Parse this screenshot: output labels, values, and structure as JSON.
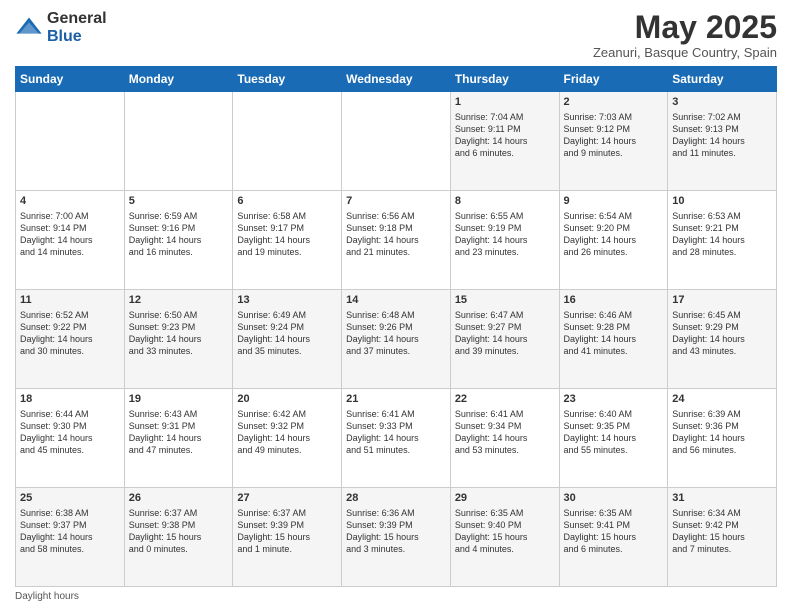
{
  "header": {
    "logo_general": "General",
    "logo_blue": "Blue",
    "month_title": "May 2025",
    "location": "Zeanuri, Basque Country, Spain"
  },
  "weekdays": [
    "Sunday",
    "Monday",
    "Tuesday",
    "Wednesday",
    "Thursday",
    "Friday",
    "Saturday"
  ],
  "weeks": [
    [
      {
        "day": "",
        "info": ""
      },
      {
        "day": "",
        "info": ""
      },
      {
        "day": "",
        "info": ""
      },
      {
        "day": "",
        "info": ""
      },
      {
        "day": "1",
        "info": "Sunrise: 7:04 AM\nSunset: 9:11 PM\nDaylight: 14 hours\nand 6 minutes."
      },
      {
        "day": "2",
        "info": "Sunrise: 7:03 AM\nSunset: 9:12 PM\nDaylight: 14 hours\nand 9 minutes."
      },
      {
        "day": "3",
        "info": "Sunrise: 7:02 AM\nSunset: 9:13 PM\nDaylight: 14 hours\nand 11 minutes."
      }
    ],
    [
      {
        "day": "4",
        "info": "Sunrise: 7:00 AM\nSunset: 9:14 PM\nDaylight: 14 hours\nand 14 minutes."
      },
      {
        "day": "5",
        "info": "Sunrise: 6:59 AM\nSunset: 9:16 PM\nDaylight: 14 hours\nand 16 minutes."
      },
      {
        "day": "6",
        "info": "Sunrise: 6:58 AM\nSunset: 9:17 PM\nDaylight: 14 hours\nand 19 minutes."
      },
      {
        "day": "7",
        "info": "Sunrise: 6:56 AM\nSunset: 9:18 PM\nDaylight: 14 hours\nand 21 minutes."
      },
      {
        "day": "8",
        "info": "Sunrise: 6:55 AM\nSunset: 9:19 PM\nDaylight: 14 hours\nand 23 minutes."
      },
      {
        "day": "9",
        "info": "Sunrise: 6:54 AM\nSunset: 9:20 PM\nDaylight: 14 hours\nand 26 minutes."
      },
      {
        "day": "10",
        "info": "Sunrise: 6:53 AM\nSunset: 9:21 PM\nDaylight: 14 hours\nand 28 minutes."
      }
    ],
    [
      {
        "day": "11",
        "info": "Sunrise: 6:52 AM\nSunset: 9:22 PM\nDaylight: 14 hours\nand 30 minutes."
      },
      {
        "day": "12",
        "info": "Sunrise: 6:50 AM\nSunset: 9:23 PM\nDaylight: 14 hours\nand 33 minutes."
      },
      {
        "day": "13",
        "info": "Sunrise: 6:49 AM\nSunset: 9:24 PM\nDaylight: 14 hours\nand 35 minutes."
      },
      {
        "day": "14",
        "info": "Sunrise: 6:48 AM\nSunset: 9:26 PM\nDaylight: 14 hours\nand 37 minutes."
      },
      {
        "day": "15",
        "info": "Sunrise: 6:47 AM\nSunset: 9:27 PM\nDaylight: 14 hours\nand 39 minutes."
      },
      {
        "day": "16",
        "info": "Sunrise: 6:46 AM\nSunset: 9:28 PM\nDaylight: 14 hours\nand 41 minutes."
      },
      {
        "day": "17",
        "info": "Sunrise: 6:45 AM\nSunset: 9:29 PM\nDaylight: 14 hours\nand 43 minutes."
      }
    ],
    [
      {
        "day": "18",
        "info": "Sunrise: 6:44 AM\nSunset: 9:30 PM\nDaylight: 14 hours\nand 45 minutes."
      },
      {
        "day": "19",
        "info": "Sunrise: 6:43 AM\nSunset: 9:31 PM\nDaylight: 14 hours\nand 47 minutes."
      },
      {
        "day": "20",
        "info": "Sunrise: 6:42 AM\nSunset: 9:32 PM\nDaylight: 14 hours\nand 49 minutes."
      },
      {
        "day": "21",
        "info": "Sunrise: 6:41 AM\nSunset: 9:33 PM\nDaylight: 14 hours\nand 51 minutes."
      },
      {
        "day": "22",
        "info": "Sunrise: 6:41 AM\nSunset: 9:34 PM\nDaylight: 14 hours\nand 53 minutes."
      },
      {
        "day": "23",
        "info": "Sunrise: 6:40 AM\nSunset: 9:35 PM\nDaylight: 14 hours\nand 55 minutes."
      },
      {
        "day": "24",
        "info": "Sunrise: 6:39 AM\nSunset: 9:36 PM\nDaylight: 14 hours\nand 56 minutes."
      }
    ],
    [
      {
        "day": "25",
        "info": "Sunrise: 6:38 AM\nSunset: 9:37 PM\nDaylight: 14 hours\nand 58 minutes."
      },
      {
        "day": "26",
        "info": "Sunrise: 6:37 AM\nSunset: 9:38 PM\nDaylight: 15 hours\nand 0 minutes."
      },
      {
        "day": "27",
        "info": "Sunrise: 6:37 AM\nSunset: 9:39 PM\nDaylight: 15 hours\nand 1 minute."
      },
      {
        "day": "28",
        "info": "Sunrise: 6:36 AM\nSunset: 9:39 PM\nDaylight: 15 hours\nand 3 minutes."
      },
      {
        "day": "29",
        "info": "Sunrise: 6:35 AM\nSunset: 9:40 PM\nDaylight: 15 hours\nand 4 minutes."
      },
      {
        "day": "30",
        "info": "Sunrise: 6:35 AM\nSunset: 9:41 PM\nDaylight: 15 hours\nand 6 minutes."
      },
      {
        "day": "31",
        "info": "Sunrise: 6:34 AM\nSunset: 9:42 PM\nDaylight: 15 hours\nand 7 minutes."
      }
    ]
  ],
  "footer": {
    "note": "Daylight hours"
  }
}
